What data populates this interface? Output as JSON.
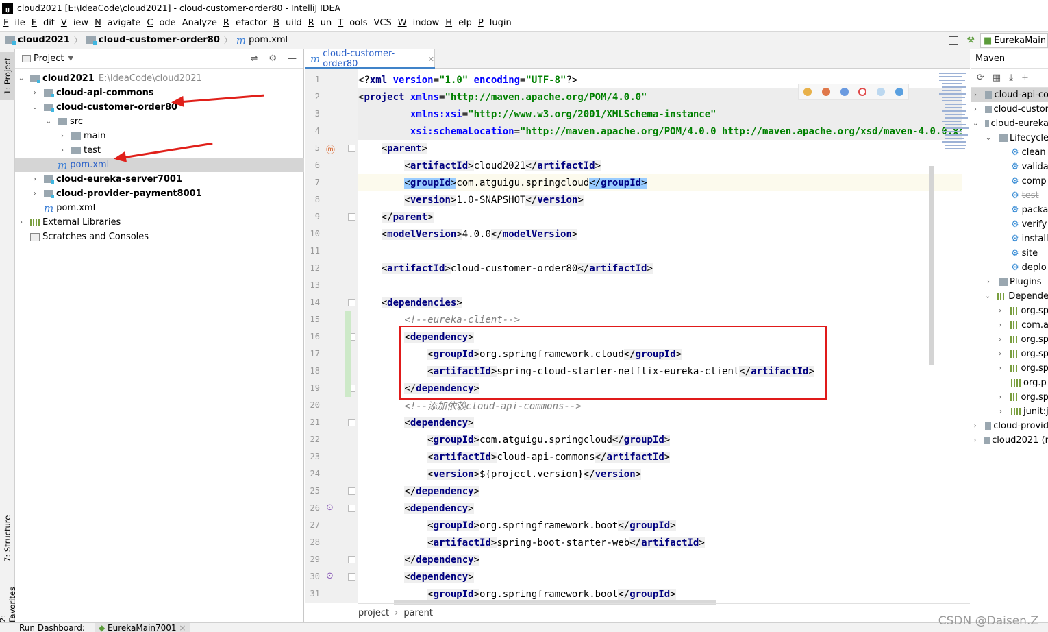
{
  "window": {
    "title": "cloud2021 [E:\\IdeaCode\\cloud2021] - cloud-customer-order80 - IntelliJ IDEA",
    "logo": "IJ"
  },
  "menu": [
    {
      "u": "F",
      "rest": "ile"
    },
    {
      "u": "E",
      "rest": "dit"
    },
    {
      "u": "V",
      "rest": "iew"
    },
    {
      "u": "N",
      "rest": "avigate"
    },
    {
      "u": "C",
      "rest": "ode"
    },
    {
      "u": "",
      "rest": "Analyze"
    },
    {
      "u": "R",
      "rest": "efactor"
    },
    {
      "u": "B",
      "rest": "uild"
    },
    {
      "u": "R",
      "rest": "un"
    },
    {
      "u": "T",
      "rest": "ools"
    },
    {
      "u": "",
      "rest": "VCS"
    },
    {
      "u": "W",
      "rest": "indow"
    },
    {
      "u": "H",
      "rest": "elp"
    },
    {
      "u": "P",
      "rest": "lugin"
    }
  ],
  "breadcrumb": {
    "root": "cloud2021",
    "module": "cloud-customer-order80",
    "file": "pom.xml"
  },
  "run_config": "EurekaMain7",
  "left_strip": {
    "project_tab": "1: Project",
    "structure_tab": "7: Structure",
    "favorites_tab": "2: Favorites"
  },
  "project_panel": {
    "title": "Project",
    "tree": [
      {
        "depth": 0,
        "chev": "v",
        "icon": "folder-mod",
        "label": "cloud2021",
        "bold": true,
        "note": "E:\\IdeaCode\\cloud2021"
      },
      {
        "depth": 1,
        "chev": ">",
        "icon": "folder-mod",
        "label": "cloud-api-commons",
        "bold": true
      },
      {
        "depth": 1,
        "chev": "v",
        "icon": "folder-mod",
        "label": "cloud-customer-order80",
        "bold": true
      },
      {
        "depth": 2,
        "chev": "v",
        "icon": "folder",
        "label": "src"
      },
      {
        "depth": 3,
        "chev": ">",
        "icon": "folder",
        "label": "main"
      },
      {
        "depth": 3,
        "chev": ">",
        "icon": "folder",
        "label": "test"
      },
      {
        "depth": 2,
        "chev": "",
        "icon": "maven",
        "label": "pom.xml",
        "selected": true,
        "blue": true
      },
      {
        "depth": 1,
        "chev": ">",
        "icon": "folder-mod",
        "label": "cloud-eureka-server7001",
        "bold": true
      },
      {
        "depth": 1,
        "chev": ">",
        "icon": "folder-mod",
        "label": "cloud-provider-payment8001",
        "bold": true
      },
      {
        "depth": 1,
        "chev": "",
        "icon": "maven",
        "label": "pom.xml"
      },
      {
        "depth": 0,
        "chev": ">",
        "icon": "lib",
        "label": "External Libraries"
      },
      {
        "depth": 0,
        "chev": "",
        "icon": "scratch",
        "label": "Scratches and Consoles"
      }
    ]
  },
  "editor": {
    "tab_label": "cloud-customer-order80",
    "breadcrumb": [
      "project",
      "parent"
    ],
    "lines": [
      {
        "n": 1,
        "parts": [
          [
            "br",
            "<?"
          ],
          [
            "tg",
            "xml "
          ],
          [
            "at",
            "version"
          ],
          [
            "br",
            "="
          ],
          [
            "av",
            "\"1.0\""
          ],
          [
            "at",
            " encoding"
          ],
          [
            "br",
            "="
          ],
          [
            "av",
            "\"UTF-8\""
          ],
          [
            "br",
            "?>"
          ]
        ]
      },
      {
        "n": 2,
        "parts": [
          [
            "br",
            "<"
          ],
          [
            "tg",
            "project "
          ],
          [
            "at",
            "xmlns"
          ],
          [
            "br",
            "="
          ],
          [
            "av",
            "\"http://maven.apache.org/POM/4.0.0\""
          ]
        ],
        "hl": true
      },
      {
        "n": 3,
        "parts": [
          [
            "tx",
            "         "
          ],
          [
            "at",
            "xmlns:xsi"
          ],
          [
            "br",
            "="
          ],
          [
            "av",
            "\"http://www.w3.org/2001/XMLSchema-instance\""
          ]
        ],
        "hl": true
      },
      {
        "n": 4,
        "parts": [
          [
            "tx",
            "         "
          ],
          [
            "at",
            "xsi:schemaLocation"
          ],
          [
            "br",
            "="
          ],
          [
            "av",
            "\"http://maven.apache.org/POM/4.0.0 http://maven.apache.org/xsd/maven-4.0.0.xsd\""
          ]
        ],
        "hl": true
      },
      {
        "n": 5,
        "parts": [
          [
            "tx",
            "    "
          ],
          [
            "tbox",
            "<"
          ],
          [
            "tboxtg",
            "parent"
          ],
          [
            "tbox",
            ">"
          ]
        ]
      },
      {
        "n": 6,
        "parts": [
          [
            "tx",
            "        "
          ],
          [
            "tbox",
            "<"
          ],
          [
            "tboxtg",
            "artifactId"
          ],
          [
            "tbox",
            ">"
          ],
          [
            "tx",
            "cloud2021"
          ],
          [
            "tbox",
            "</"
          ],
          [
            "tboxtg",
            "artifactId"
          ],
          [
            "tbox",
            ">"
          ]
        ]
      },
      {
        "n": 7,
        "parts": [
          [
            "tx",
            "        "
          ],
          [
            "tsel",
            "<"
          ],
          [
            "tseltg",
            "groupId"
          ],
          [
            "tsel",
            ">"
          ],
          [
            "tx",
            "com.atguigu.springcloud"
          ],
          [
            "tsel",
            "</"
          ],
          [
            "tseltg",
            "groupId"
          ],
          [
            "tsel",
            ">"
          ]
        ],
        "current": true
      },
      {
        "n": 8,
        "parts": [
          [
            "tx",
            "        "
          ],
          [
            "tbox",
            "<"
          ],
          [
            "tboxtg",
            "version"
          ],
          [
            "tbox",
            ">"
          ],
          [
            "tx",
            "1.0-SNAPSHOT"
          ],
          [
            "tbox",
            "</"
          ],
          [
            "tboxtg",
            "version"
          ],
          [
            "tbox",
            ">"
          ]
        ]
      },
      {
        "n": 9,
        "parts": [
          [
            "tx",
            "    "
          ],
          [
            "tbox",
            "</"
          ],
          [
            "tboxtg",
            "parent"
          ],
          [
            "tbox",
            ">"
          ]
        ]
      },
      {
        "n": 10,
        "parts": [
          [
            "tx",
            "    "
          ],
          [
            "tbox",
            "<"
          ],
          [
            "tboxtg",
            "modelVersion"
          ],
          [
            "tbox",
            ">"
          ],
          [
            "tx",
            "4.0.0"
          ],
          [
            "tbox",
            "</"
          ],
          [
            "tboxtg",
            "modelVersion"
          ],
          [
            "tbox",
            ">"
          ]
        ]
      },
      {
        "n": 11,
        "parts": []
      },
      {
        "n": 12,
        "parts": [
          [
            "tx",
            "    "
          ],
          [
            "tbox",
            "<"
          ],
          [
            "tboxtg",
            "artifactId"
          ],
          [
            "tbox",
            ">"
          ],
          [
            "tx",
            "cloud-customer-order80"
          ],
          [
            "tbox",
            "</"
          ],
          [
            "tboxtg",
            "artifactId"
          ],
          [
            "tbox",
            ">"
          ]
        ]
      },
      {
        "n": 13,
        "parts": []
      },
      {
        "n": 14,
        "parts": [
          [
            "tx",
            "    "
          ],
          [
            "tbox",
            "<"
          ],
          [
            "tboxtg",
            "dependencies"
          ],
          [
            "tbox",
            ">"
          ]
        ]
      },
      {
        "n": 15,
        "parts": [
          [
            "tx",
            "        "
          ],
          [
            "cm",
            "<!--eureka-client-->"
          ]
        ]
      },
      {
        "n": 16,
        "parts": [
          [
            "tx",
            "        "
          ],
          [
            "tbox",
            "<"
          ],
          [
            "tboxtg",
            "dependency"
          ],
          [
            "tbox",
            ">"
          ]
        ]
      },
      {
        "n": 17,
        "parts": [
          [
            "tx",
            "            "
          ],
          [
            "tbox",
            "<"
          ],
          [
            "tboxtg",
            "groupId"
          ],
          [
            "tbox",
            ">"
          ],
          [
            "tx",
            "org.springframework.cloud"
          ],
          [
            "tbox",
            "</"
          ],
          [
            "tboxtg",
            "groupId"
          ],
          [
            "tbox",
            ">"
          ]
        ]
      },
      {
        "n": 18,
        "parts": [
          [
            "tx",
            "            "
          ],
          [
            "tbox",
            "<"
          ],
          [
            "tboxtg",
            "artifactId"
          ],
          [
            "tbox",
            ">"
          ],
          [
            "tx",
            "spring-cloud-starter-netflix-eureka-client"
          ],
          [
            "tbox",
            "</"
          ],
          [
            "tboxtg",
            "artifactId"
          ],
          [
            "tbox",
            ">"
          ]
        ]
      },
      {
        "n": 19,
        "parts": [
          [
            "tx",
            "        "
          ],
          [
            "tbox",
            "</"
          ],
          [
            "tboxtg",
            "dependency"
          ],
          [
            "tbox",
            ">"
          ]
        ]
      },
      {
        "n": 20,
        "parts": [
          [
            "tx",
            "        "
          ],
          [
            "cm",
            "<!--添加依赖cloud-api-commons-->"
          ]
        ]
      },
      {
        "n": 21,
        "parts": [
          [
            "tx",
            "        "
          ],
          [
            "tbox",
            "<"
          ],
          [
            "tboxtg",
            "dependency"
          ],
          [
            "tbox",
            ">"
          ]
        ]
      },
      {
        "n": 22,
        "parts": [
          [
            "tx",
            "            "
          ],
          [
            "tbox",
            "<"
          ],
          [
            "tboxtg",
            "groupId"
          ],
          [
            "tbox",
            ">"
          ],
          [
            "tx",
            "com.atguigu.springcloud"
          ],
          [
            "tbox",
            "</"
          ],
          [
            "tboxtg",
            "groupId"
          ],
          [
            "tbox",
            ">"
          ]
        ]
      },
      {
        "n": 23,
        "parts": [
          [
            "tx",
            "            "
          ],
          [
            "tbox",
            "<"
          ],
          [
            "tboxtg",
            "artifactId"
          ],
          [
            "tbox",
            ">"
          ],
          [
            "tx",
            "cloud-api-commons"
          ],
          [
            "tbox",
            "</"
          ],
          [
            "tboxtg",
            "artifactId"
          ],
          [
            "tbox",
            ">"
          ]
        ]
      },
      {
        "n": 24,
        "parts": [
          [
            "tx",
            "            "
          ],
          [
            "tbox",
            "<"
          ],
          [
            "tboxtg",
            "version"
          ],
          [
            "tbox",
            ">"
          ],
          [
            "tx",
            "${project.version}"
          ],
          [
            "tbox",
            "</"
          ],
          [
            "tboxtg",
            "version"
          ],
          [
            "tbox",
            ">"
          ]
        ]
      },
      {
        "n": 25,
        "parts": [
          [
            "tx",
            "        "
          ],
          [
            "tbox",
            "</"
          ],
          [
            "tboxtg",
            "dependency"
          ],
          [
            "tbox",
            ">"
          ]
        ]
      },
      {
        "n": 26,
        "parts": [
          [
            "tx",
            "        "
          ],
          [
            "tbox",
            "<"
          ],
          [
            "tboxtg",
            "dependency"
          ],
          [
            "tbox",
            ">"
          ]
        ]
      },
      {
        "n": 27,
        "parts": [
          [
            "tx",
            "            "
          ],
          [
            "tbox",
            "<"
          ],
          [
            "tboxtg",
            "groupId"
          ],
          [
            "tbox",
            ">"
          ],
          [
            "tx",
            "org.springframework.boot"
          ],
          [
            "tbox",
            "</"
          ],
          [
            "tboxtg",
            "groupId"
          ],
          [
            "tbox",
            ">"
          ]
        ]
      },
      {
        "n": 28,
        "parts": [
          [
            "tx",
            "            "
          ],
          [
            "tbox",
            "<"
          ],
          [
            "tboxtg",
            "artifactId"
          ],
          [
            "tbox",
            ">"
          ],
          [
            "tx",
            "spring-boot-starter-web"
          ],
          [
            "tbox",
            "</"
          ],
          [
            "tboxtg",
            "artifactId"
          ],
          [
            "tbox",
            ">"
          ]
        ]
      },
      {
        "n": 29,
        "parts": [
          [
            "tx",
            "        "
          ],
          [
            "tbox",
            "</"
          ],
          [
            "tboxtg",
            "dependency"
          ],
          [
            "tbox",
            ">"
          ]
        ]
      },
      {
        "n": 30,
        "parts": [
          [
            "tx",
            "        "
          ],
          [
            "tbox",
            "<"
          ],
          [
            "tboxtg",
            "dependency"
          ],
          [
            "tbox",
            ">"
          ]
        ]
      },
      {
        "n": 31,
        "parts": [
          [
            "tx",
            "            "
          ],
          [
            "tbox",
            "<"
          ],
          [
            "tboxtg",
            "groupId"
          ],
          [
            "tbox",
            ">"
          ],
          [
            "tx",
            "org.springframework.boot"
          ],
          [
            "tbox",
            "</"
          ],
          [
            "tboxtg",
            "groupId"
          ],
          [
            "tbox",
            ">"
          ]
        ]
      }
    ]
  },
  "maven_panel": {
    "title": "Maven",
    "rows": [
      {
        "ind": 0,
        "chev": ">",
        "icon": "mod",
        "label": "cloud-api-co",
        "sel": true
      },
      {
        "ind": 0,
        "chev": ">",
        "icon": "mod",
        "label": "cloud-custor"
      },
      {
        "ind": 0,
        "chev": "v",
        "icon": "mod",
        "label": "cloud-eureka"
      },
      {
        "ind": 1,
        "chev": "v",
        "icon": "mod",
        "label": "Lifecycle"
      },
      {
        "ind": 2,
        "chev": "",
        "icon": "gear",
        "label": "clean"
      },
      {
        "ind": 2,
        "chev": "",
        "icon": "gear",
        "label": "valida"
      },
      {
        "ind": 2,
        "chev": "",
        "icon": "gear",
        "label": "comp"
      },
      {
        "ind": 2,
        "chev": "",
        "icon": "gear",
        "label": "test",
        "strike": true
      },
      {
        "ind": 2,
        "chev": "",
        "icon": "gear",
        "label": "packa"
      },
      {
        "ind": 2,
        "chev": "",
        "icon": "gear",
        "label": "verify"
      },
      {
        "ind": 2,
        "chev": "",
        "icon": "gear",
        "label": "install"
      },
      {
        "ind": 2,
        "chev": "",
        "icon": "gear",
        "label": "site"
      },
      {
        "ind": 2,
        "chev": "",
        "icon": "gear",
        "label": "deplo"
      },
      {
        "ind": 1,
        "chev": ">",
        "icon": "mod",
        "label": "Plugins"
      },
      {
        "ind": 1,
        "chev": "v",
        "icon": "lib",
        "label": "Depende"
      },
      {
        "ind": 2,
        "chev": ">",
        "icon": "lib",
        "label": "org.sp"
      },
      {
        "ind": 2,
        "chev": ">",
        "icon": "lib",
        "label": "com.a"
      },
      {
        "ind": 2,
        "chev": ">",
        "icon": "lib",
        "label": "org.sp"
      },
      {
        "ind": 2,
        "chev": ">",
        "icon": "lib",
        "label": "org.sp"
      },
      {
        "ind": 2,
        "chev": ">",
        "icon": "lib",
        "label": "org.sp"
      },
      {
        "ind": 2,
        "chev": "",
        "icon": "lib",
        "label": "org.p"
      },
      {
        "ind": 2,
        "chev": ">",
        "icon": "lib",
        "label": "org.sp"
      },
      {
        "ind": 2,
        "chev": ">",
        "icon": "lib",
        "label": "junit:j"
      },
      {
        "ind": 0,
        "chev": ">",
        "icon": "mod",
        "label": "cloud-provid"
      },
      {
        "ind": 0,
        "chev": ">",
        "icon": "mod",
        "label": "cloud2021 (r"
      }
    ]
  },
  "bottom": {
    "run_dashboard": "Run Dashboard:",
    "run_tab": "EurekaMain7001"
  },
  "watermark": "CSDN @Daisen.Z"
}
